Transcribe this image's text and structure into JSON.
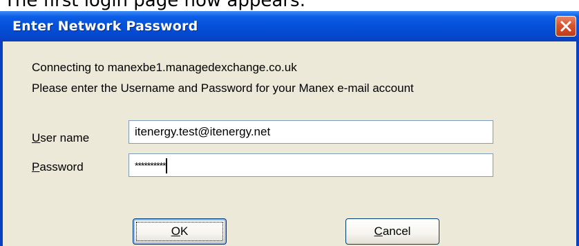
{
  "caption": "The first login page now appears:",
  "dialog": {
    "title": "Enter Network Password",
    "close_glyph": "✕",
    "connecting_text": "Connecting to manexbe1.managedexchange.co.uk",
    "instruction_text": "Please enter the Username and Password for your Manex e-mail account",
    "username": {
      "label_mnemonic": "U",
      "label_rest": "ser name",
      "value": "itenergy.test@itenergy.net"
    },
    "password": {
      "label_mnemonic": "P",
      "label_rest": "assword",
      "masked_value": "**********"
    },
    "buttons": {
      "ok_mnemonic": "O",
      "ok_rest": "K",
      "cancel_mnemonic": "C",
      "cancel_rest": "ancel"
    }
  }
}
